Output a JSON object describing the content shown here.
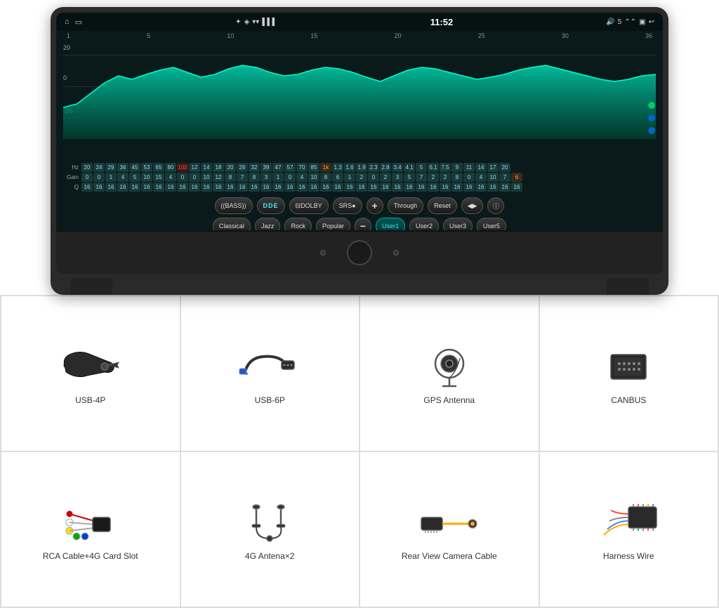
{
  "device": {
    "status_bar": {
      "left_icons": [
        "home-icon",
        "screenshot-icon"
      ],
      "bluetooth": "✦",
      "wifi": "▾",
      "signal": "▾▾",
      "time": "11:52",
      "volume_icon": "🔊",
      "volume_level": "5",
      "expand_icon": "⌃⌃",
      "window_icon": "▣",
      "back_icon": "↩"
    },
    "eq_numbers_top": [
      "1",
      "5",
      "10",
      "15",
      "20",
      "25",
      "30",
      "36"
    ],
    "db_labels": [
      "20",
      "-",
      "0",
      "-",
      "-20"
    ],
    "hz_row": {
      "label": "Hz",
      "values": [
        "20",
        "24",
        "29",
        "36",
        "45",
        "53",
        "65",
        "80",
        "100",
        "12",
        "14",
        "18",
        "20",
        "26",
        "32",
        "39",
        "47",
        "57",
        "70",
        "85",
        "1k",
        "1.3",
        "1.6",
        "1.9",
        "2.3",
        "2.8",
        "3.4",
        "4.1",
        "5",
        "6.1",
        "7.5",
        "9",
        "11",
        "14",
        "17",
        "20"
      ]
    },
    "gain_row": {
      "label": "Gain",
      "values": [
        "0",
        "0",
        "1",
        "4",
        "5",
        "10",
        "15",
        "4",
        "0",
        "0",
        "10",
        "12",
        "8",
        "7",
        "8",
        "3",
        "1",
        "0",
        "4",
        "10",
        "8",
        "6",
        "1",
        "2",
        "0",
        "2",
        "3",
        "5",
        "7",
        "2",
        "2",
        "8",
        "0",
        "4",
        "10",
        "7",
        "6"
      ]
    },
    "q_row": {
      "label": "Q",
      "values": [
        "16",
        "16",
        "16",
        "16",
        "16",
        "16",
        "16",
        "16",
        "16",
        "16",
        "16",
        "16",
        "16",
        "16",
        "16",
        "16",
        "16",
        "16",
        "16",
        "16",
        "16",
        "16",
        "16",
        "16",
        "16",
        "16",
        "16",
        "16",
        "16",
        "16",
        "16",
        "16",
        "16",
        "16",
        "16",
        "16",
        "16"
      ]
    },
    "controls": {
      "bass_label": "((BASS))",
      "dde_label": "DDE",
      "dolby_label": "⊟DOLBY",
      "srs_label": "SRS●",
      "plus_label": "+",
      "through_label": "Through",
      "reset_label": "Reset",
      "speaker_label": "◀▶",
      "info_label": "ⓘ",
      "minus_label": "−"
    },
    "presets": {
      "classical": "Classical",
      "jazz": "Jazz",
      "rock": "Rock",
      "popular": "Popular",
      "user1": "User1",
      "user2": "User2",
      "user3": "User3",
      "user5": "User5"
    }
  },
  "accessories": [
    {
      "id": "usb-4p",
      "label": "USB-4P",
      "icon_type": "cable-coiled"
    },
    {
      "id": "usb-6p",
      "label": "USB-6P",
      "icon_type": "cable-connector"
    },
    {
      "id": "gps-antenna",
      "label": "GPS Antenna",
      "icon_type": "gps-round"
    },
    {
      "id": "canbus",
      "label": "CANBUS",
      "icon_type": "module-box"
    },
    {
      "id": "rca-cable",
      "label": "RCA Cable+4G Card Slot",
      "icon_type": "rca-multicolored"
    },
    {
      "id": "4g-antenna",
      "label": "4G Antena×2",
      "icon_type": "antenna-2"
    },
    {
      "id": "rear-camera-cable",
      "label": "Rear View Camera Cable",
      "icon_type": "rj45-cable"
    },
    {
      "id": "harness-wire",
      "label": "Harness Wire",
      "icon_type": "harness-connector"
    }
  ]
}
